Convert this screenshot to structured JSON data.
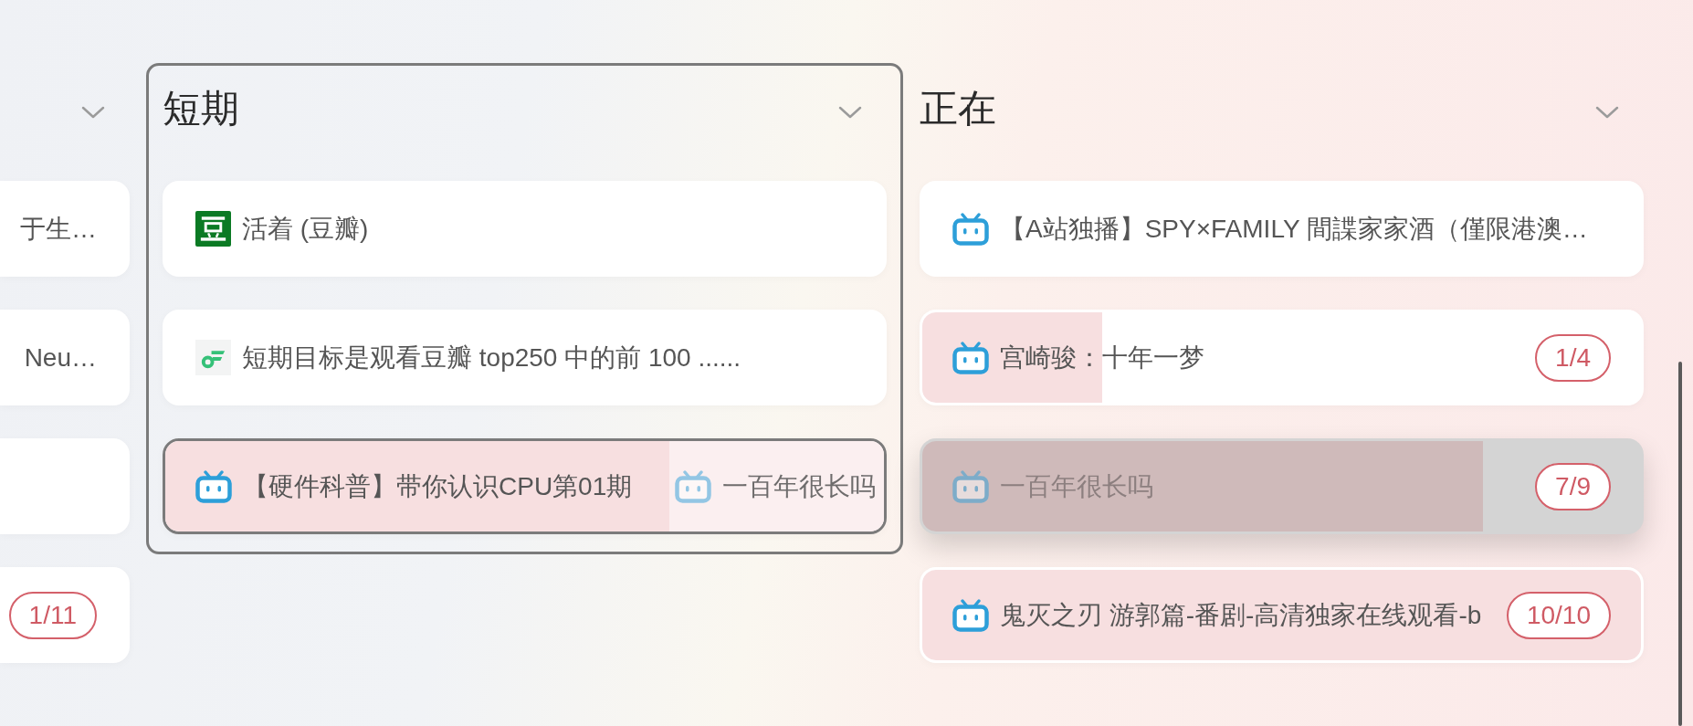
{
  "board": {
    "columns": [
      {
        "cut_at_left_edge": true,
        "highlighted": false,
        "cards": [
          {
            "kind": "plain",
            "title": "于生…",
            "drop_target": false,
            "dragging": false
          },
          {
            "kind": "plain",
            "title": "Neu…",
            "drop_target": false,
            "dragging": false
          },
          {
            "kind": "plain",
            "drop_target": false,
            "dragging": false
          },
          {
            "kind": "plain",
            "badge": "1/11",
            "drop_target": false,
            "dragging": false
          }
        ]
      },
      {
        "title": "短期",
        "cut_at_left_edge": false,
        "highlighted": true,
        "cards": [
          {
            "kind": "douban",
            "title": "活着 (豆瓣)",
            "drop_target": false,
            "dragging": false
          },
          {
            "kind": "note",
            "title": "短期目标是观看豆瓣 top250 中的前 100 ......",
            "drop_target": false,
            "dragging": false
          },
          {
            "kind": "bilibili",
            "title": "【硬件科普】带你认识CPU第01期",
            "level": 1,
            "drop_target": true,
            "dragging": false
          }
        ]
      },
      {
        "title": "正在",
        "cut_at_left_edge": false,
        "highlighted": false,
        "cards": [
          {
            "kind": "bilibili",
            "title": "【A站独播】SPY×FAMILY 間諜家家酒（僅限港澳…",
            "drop_target": false,
            "dragging": false
          },
          {
            "kind": "bilibili",
            "title": "宫崎骏：十年一梦",
            "badge": "1/4",
            "level": 0.25,
            "drop_target": false,
            "dragging": false
          },
          {
            "kind": "bilibili",
            "title": "一百年很长吗",
            "badge": "7/9",
            "level": 0.78,
            "drop_target": false,
            "dragging": true
          },
          {
            "kind": "bilibili",
            "title": "鬼灭之刃 游郭篇-番剧-高清独家在线观看-b",
            "badge": "10/10",
            "level": 1,
            "drop_target": false,
            "dragging": false
          }
        ]
      }
    ]
  },
  "drag_preview": {
    "kind": "bilibili",
    "title": "一百年很长吗"
  }
}
